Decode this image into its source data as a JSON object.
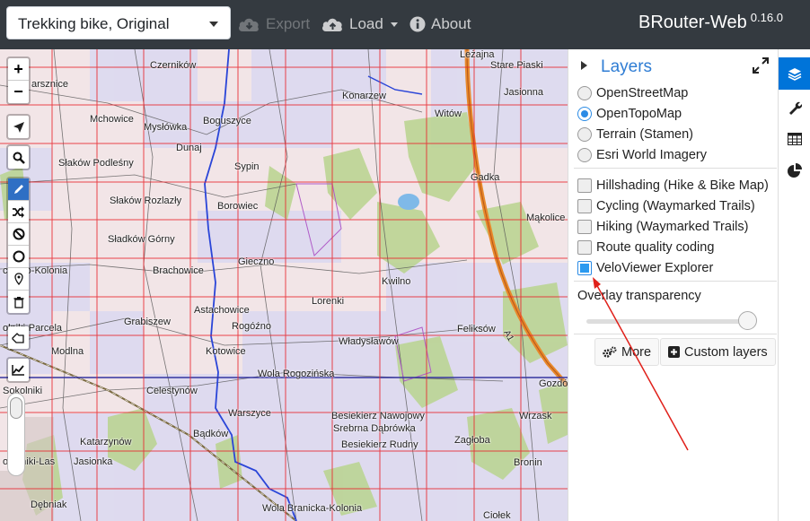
{
  "navbar": {
    "profile": "Trekking bike, Original",
    "export_label": "Export",
    "load_label": "Load",
    "about_label": "About",
    "brand": "BRouter-Web",
    "version": "0.16.0"
  },
  "map": {
    "places": [
      "Czerników",
      "Leżajna",
      "Stare Piaski",
      "arsznice",
      "Mchowice",
      "Mysłówka",
      "Boguszyce",
      "Konarzew",
      "Witów",
      "Jasionna",
      "Dunaj",
      "Sypin",
      "Słaków Podleśny",
      "Gadka",
      "Słaków Rozlazły",
      "Borowiec",
      "Mąkolice",
      "Sładków Górny",
      "chowo-Kolonia",
      "Brachowice",
      "Gieczno",
      "Kwilno",
      "Lorenki",
      "Astachowice",
      "Grabiszew",
      "olniki-Parcela",
      "Rogóźno",
      "Feliksów",
      "Władysławów",
      "Modlna",
      "Kotowice",
      "Wola Rogozińska",
      "Gozdów",
      "Sokolniki",
      "Celestynów",
      "Warszyce",
      "Besiekierz Nawojowy",
      "Srebrna Dąbrówka",
      "Wrzask",
      "Bądków",
      "Besiekierz Rudny",
      "Zagłoba",
      "Katarzynów",
      "okolniki-Las",
      "Jasionka",
      "Bronin",
      "Dębniak",
      "Wola Branicka-Kolonia",
      "Ciołek",
      "A1"
    ]
  },
  "layers_panel": {
    "title": "Layers",
    "base_layers": [
      {
        "label": "OpenStreetMap",
        "selected": false
      },
      {
        "label": "OpenTopoMap",
        "selected": true
      },
      {
        "label": "Terrain (Stamen)",
        "selected": false
      },
      {
        "label": "Esri World Imagery",
        "selected": false
      }
    ],
    "overlays": [
      {
        "label": "Hillshading (Hike & Bike Map)",
        "checked": false
      },
      {
        "label": "Cycling (Waymarked Trails)",
        "checked": false
      },
      {
        "label": "Hiking (Waymarked Trails)",
        "checked": false
      },
      {
        "label": "Route quality coding",
        "checked": false
      },
      {
        "label": "VeloViewer Explorer",
        "checked": true
      }
    ],
    "overlay_transparency_label": "Overlay transparency",
    "overlay_transparency": 1.0,
    "more_label": "More",
    "custom_layers_label": "Custom layers"
  },
  "colors": {
    "navbar": "#343a40",
    "accent": "#0074d9",
    "grid": "#e8262e",
    "highway": "#e8892b",
    "river": "#2a45d8"
  },
  "icons": [
    "cloud-download-icon",
    "cloud-upload-icon",
    "info-icon",
    "expand-icon",
    "layers-icon",
    "wrench-icon",
    "table-icon",
    "pie-chart-icon"
  ]
}
